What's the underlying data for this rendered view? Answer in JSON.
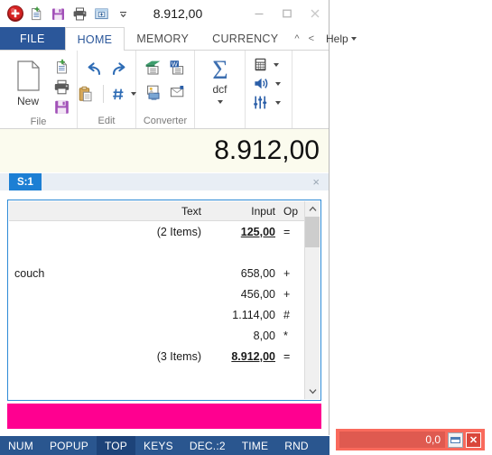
{
  "window": {
    "title": "8.912,00",
    "app_icon": "app-logo-icon",
    "quick_access": [
      {
        "name": "new-document-icon",
        "label": "New"
      },
      {
        "name": "save-icon",
        "label": "Save"
      },
      {
        "name": "print-icon",
        "label": "Print"
      },
      {
        "name": "screenshot-icon",
        "label": "Capture"
      },
      {
        "name": "customize-qat-icon",
        "label": "Customize Quick Access Toolbar"
      }
    ],
    "controls": {
      "minimize": "Minimize",
      "maximize": "Maximize",
      "close": "Close"
    }
  },
  "ribbon": {
    "tabs": [
      {
        "label": "FILE",
        "active": false,
        "kind": "file"
      },
      {
        "label": "HOME",
        "active": true,
        "kind": "normal"
      },
      {
        "label": "MEMORY",
        "active": false,
        "kind": "normal"
      },
      {
        "label": "CURRENCY",
        "active": false,
        "kind": "normal"
      }
    ],
    "collapse_caret": "^",
    "scroll_left": "<",
    "help_label": "Help",
    "groups": [
      {
        "label": "File",
        "big_button": {
          "label": "New",
          "icon": "new-page-icon"
        },
        "small_buttons": [
          {
            "name": "new-from-template-icon",
            "label": "New from template"
          },
          {
            "name": "print-icon",
            "label": "Print"
          },
          {
            "name": "save-icon",
            "label": "Save"
          }
        ]
      },
      {
        "label": "Edit",
        "small_buttons": [
          {
            "name": "undo-icon",
            "label": "Undo"
          },
          {
            "name": "redo-icon",
            "label": "Redo"
          },
          {
            "name": "paste-icon",
            "label": "Paste"
          },
          {
            "name": "number-format-icon",
            "label": "Number format"
          }
        ]
      },
      {
        "label": "Converter",
        "small_buttons": [
          {
            "name": "export-excel-icon",
            "label": "Export to Excel"
          },
          {
            "name": "export-word-icon",
            "label": "Export to Word"
          },
          {
            "name": "export-image-icon",
            "label": "Export image"
          },
          {
            "name": "export-email-icon",
            "label": "Send as email"
          }
        ]
      },
      {
        "label": "",
        "sum_button": {
          "label": "dcf",
          "icon": "sigma-icon"
        }
      },
      {
        "label": "",
        "small_buttons": [
          {
            "name": "calculator-icon",
            "label": "Calculator"
          },
          {
            "name": "sound-icon",
            "label": "Sound"
          },
          {
            "name": "settings-sliders-icon",
            "label": "Settings"
          }
        ]
      }
    ]
  },
  "display": {
    "value": "8.912,00"
  },
  "sheet": {
    "tab_label": "S:1",
    "close_label": "×"
  },
  "tape": {
    "columns": [
      "Text",
      "Input",
      "Op"
    ],
    "rows": [
      {
        "text": "(2 Items)",
        "text_align": "right",
        "input": "125,00",
        "op": "=",
        "emphasis": true
      },
      {
        "text": "",
        "text_align": "left",
        "input": "",
        "op": "",
        "emphasis": false
      },
      {
        "text": "couch",
        "text_align": "left",
        "input": "658,00",
        "op": "+",
        "emphasis": false
      },
      {
        "text": "",
        "text_align": "left",
        "input": "456,00",
        "op": "+",
        "emphasis": false
      },
      {
        "text": "",
        "text_align": "left",
        "input": "1.114,00",
        "op": "#",
        "emphasis": false
      },
      {
        "text": "",
        "text_align": "left",
        "input": "8,00",
        "op": "*",
        "emphasis": false
      },
      {
        "text": "(3 Items)",
        "text_align": "right",
        "input": "8.912,00",
        "op": "=",
        "emphasis": true
      }
    ],
    "scrollbar": {
      "up": "⌃",
      "down": "⌄"
    }
  },
  "status_bar": {
    "items": [
      {
        "label": "NUM",
        "active": false
      },
      {
        "label": "POPUP",
        "active": false
      },
      {
        "label": "TOP",
        "active": true
      },
      {
        "label": "KEYS",
        "active": false
      },
      {
        "label": "DEC.:2",
        "active": false
      },
      {
        "label": "TIME",
        "active": false
      },
      {
        "label": "RND",
        "active": false
      }
    ]
  },
  "mini_widget": {
    "value": "0,0",
    "restore_label": "Restore",
    "close_label": "✕"
  },
  "colors": {
    "file_tab": "#2b579a",
    "active_tab_text": "#2b579a",
    "display_bg": "#fbfbee",
    "sheet_tab": "#1c7fd4",
    "tape_border": "#2e8bd6",
    "pink_bar": "#ff0090",
    "status_bar": "#2a568f",
    "status_active": "#1d4379",
    "widget_red": "#f96a5c"
  }
}
